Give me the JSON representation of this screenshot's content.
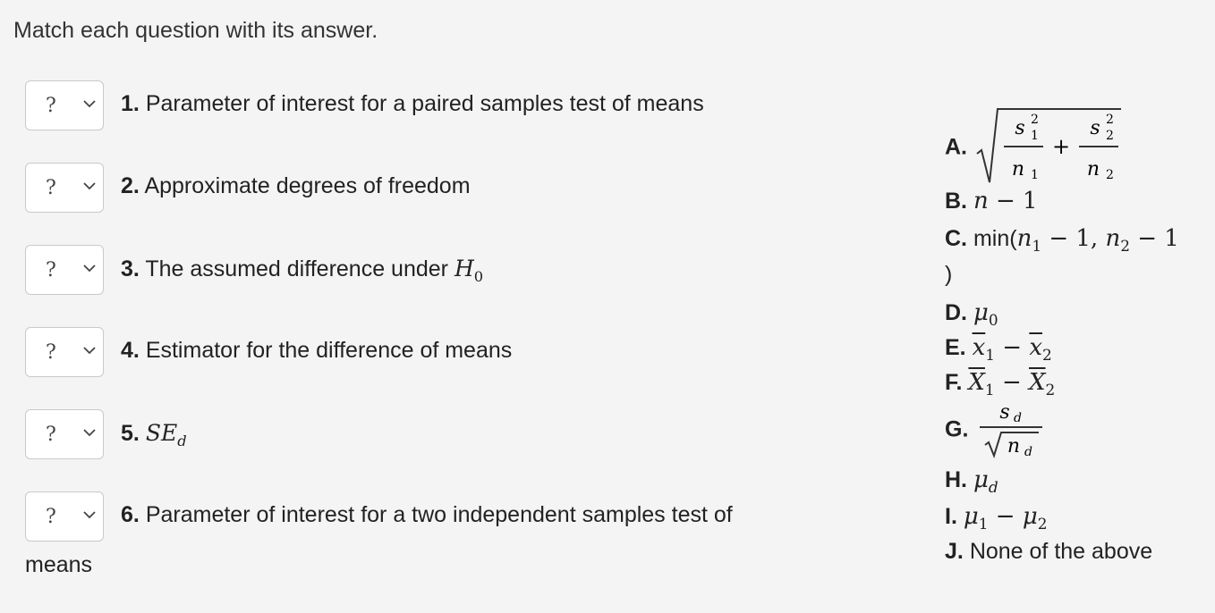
{
  "prompt": "Match each question with its answer.",
  "questions": [
    {
      "select_value": "?",
      "number": "1.",
      "text": "Parameter of interest for a paired samples test of means"
    },
    {
      "select_value": "?",
      "number": "2.",
      "text": "Approximate degrees of freedom"
    },
    {
      "select_value": "?",
      "number": "3.",
      "text": "The assumed difference under ",
      "math": "H0"
    },
    {
      "select_value": "?",
      "number": "4.",
      "text": "Estimator for the difference of means"
    },
    {
      "select_value": "?",
      "number": "5.",
      "text": "",
      "math": "SEd"
    },
    {
      "select_value": "?",
      "number": "6.",
      "text": "Parameter of interest for a two independent samples test of",
      "text_wrap": "means"
    }
  ],
  "answers": [
    {
      "letter": "A.",
      "math": "sqrt(s1^2/n1 + s2^2/n2)"
    },
    {
      "letter": "B.",
      "math": "n − 1"
    },
    {
      "letter": "C.",
      "text": "min(",
      "math": "n1 − 1, n2 − 1",
      "text_wrap": ")"
    },
    {
      "letter": "D.",
      "math": "μ0"
    },
    {
      "letter": "E.",
      "math": "x̄1 − x̄2"
    },
    {
      "letter": "F.",
      "math": "X̄1 − X̄2"
    },
    {
      "letter": "G.",
      "math": "sd/√nd"
    },
    {
      "letter": "H.",
      "math": "μd"
    },
    {
      "letter": "I.",
      "math": "μ1 − μ2"
    },
    {
      "letter": "J.",
      "text": "None of the above"
    }
  ],
  "icons": {
    "dropdown": "chevron-down-icon"
  },
  "colors": {
    "background": "#f4f4f4",
    "select_border": "#c9c9c9",
    "text": "#222222"
  }
}
